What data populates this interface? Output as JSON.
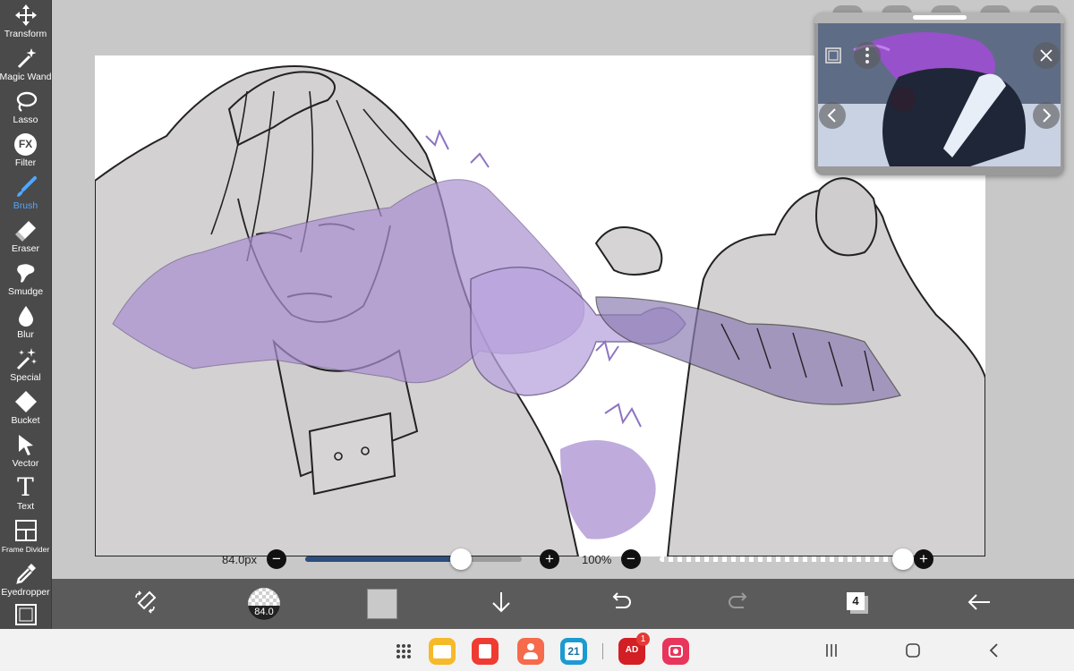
{
  "tools": [
    {
      "label": "Transform",
      "icon": "move-arrows-icon"
    },
    {
      "label": "Magic Wand",
      "icon": "magic-wand-icon"
    },
    {
      "label": "Lasso",
      "icon": "lasso-icon"
    },
    {
      "label": "Filter",
      "icon": "fx-filter-icon",
      "glyph": "FX"
    },
    {
      "label": "Brush",
      "icon": "brush-icon"
    },
    {
      "label": "Eraser",
      "icon": "eraser-icon"
    },
    {
      "label": "Smudge",
      "icon": "smudge-icon"
    },
    {
      "label": "Blur",
      "icon": "blur-drop-icon"
    },
    {
      "label": "Special",
      "icon": "special-sparkle-icon"
    },
    {
      "label": "Bucket",
      "icon": "bucket-icon"
    },
    {
      "label": "Vector",
      "icon": "vector-cursor-icon"
    },
    {
      "label": "Text",
      "icon": "text-icon",
      "glyph": "T"
    },
    {
      "label": "Frame Divider",
      "icon": "frame-divider-icon"
    },
    {
      "label": "Eyedropper",
      "icon": "eyedropper-icon"
    },
    {
      "label": "",
      "icon": "canvas-icon"
    }
  ],
  "active_tool": "Brush",
  "sliders": {
    "size_label": "84.0px",
    "size_fraction": 0.72,
    "opacity_label": "100%",
    "opacity_fraction": 1.0,
    "minus": "−",
    "plus": "+"
  },
  "toolbar": {
    "brush_size_badge": "84.0",
    "layers_count": "4",
    "color_swatch": "#c9c9c9",
    "icons": [
      "swap-color-icon",
      "brush-size-icon",
      "color-swatch",
      "download-arrow-icon",
      "undo-icon",
      "redo-icon",
      "layers-icon",
      "back-arrow-icon"
    ]
  },
  "dock": {
    "apps": [
      {
        "name": "app-drawer-icon"
      },
      {
        "name": "my-files-app",
        "color": "#f6b928"
      },
      {
        "name": "notes-app",
        "color": "#ef3b32"
      },
      {
        "name": "contacts-app",
        "color": "#f56b4b"
      },
      {
        "name": "calendar-app",
        "color": "#1b9bd1",
        "text": "21"
      },
      {
        "name": "ad-blocker-app",
        "color": "#d21e24",
        "text": "AD",
        "badge": "1"
      },
      {
        "name": "camera-app",
        "color": "#e8355c"
      }
    ],
    "nav": [
      "recent-apps-icon",
      "home-icon",
      "back-icon"
    ]
  },
  "colors": {
    "sidebar": "#4a4a4a",
    "toolbar": "#5b5b5b",
    "accent": "#4fa8ff",
    "ink_purple": "#a98fd0",
    "size_track_fill": "#2c4e7e"
  }
}
